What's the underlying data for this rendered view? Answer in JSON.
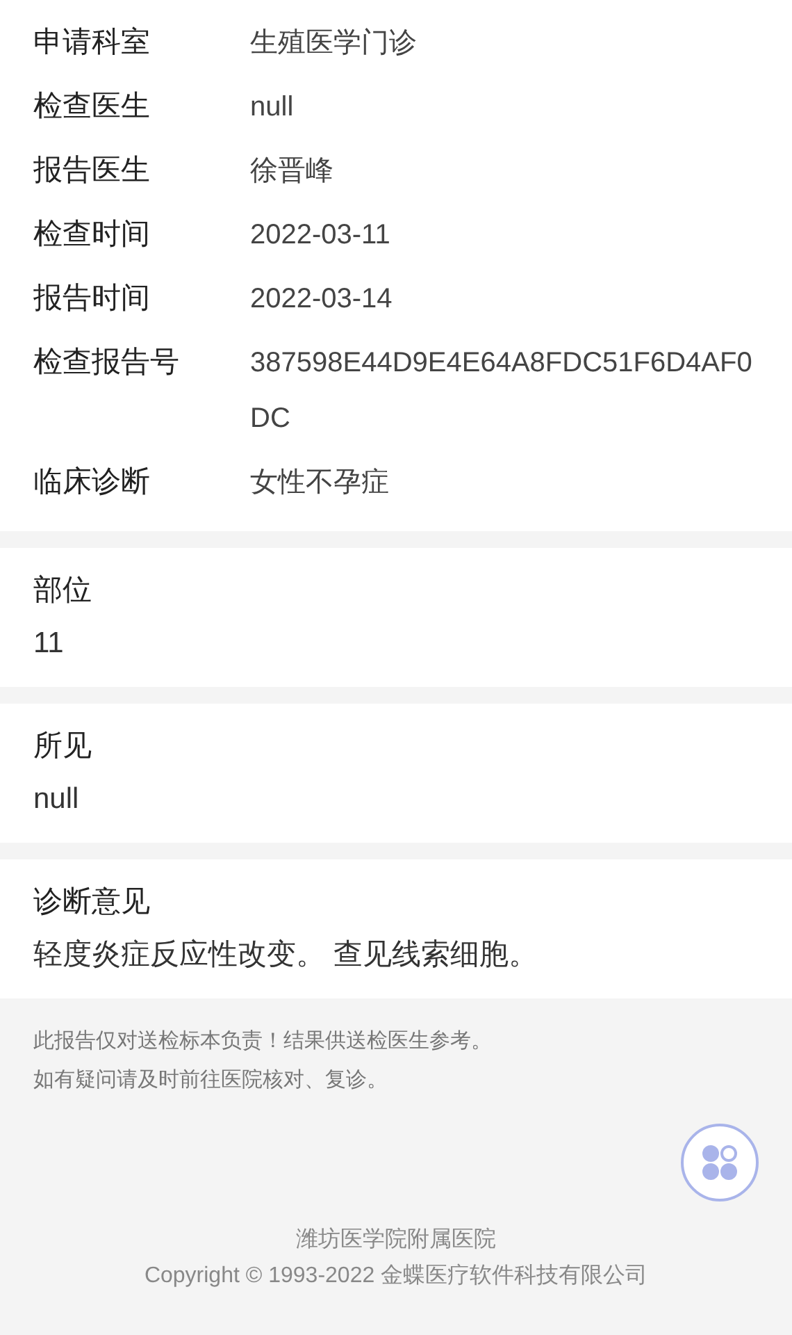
{
  "info_rows": [
    {
      "label": "申请科室",
      "value": "生殖医学门诊"
    },
    {
      "label": "检查医生",
      "value": "null"
    },
    {
      "label": "报告医生",
      "value": "徐晋峰"
    },
    {
      "label": "检查时间",
      "value": "2022-03-11"
    },
    {
      "label": "报告时间",
      "value": "2022-03-14"
    },
    {
      "label": "检查报告号",
      "value": "387598E44D9E4E64A8FDC51F6D4AF0DC"
    },
    {
      "label": "临床诊断",
      "value": "女性不孕症"
    }
  ],
  "sections": [
    {
      "title": "部位",
      "body": "11"
    },
    {
      "title": "所见",
      "body": "null"
    },
    {
      "title": "诊断意见",
      "body": "轻度炎症反应性改变。 查见线索细胞。"
    }
  ],
  "notice": [
    "此报告仅对送检标本负责！结果供送检医生参考。",
    "如有疑问请及时前往医院核对、复诊。"
  ],
  "footer": {
    "hospital": "潍坊医学院附属医院",
    "copyright": "Copyright © 1993-2022 金蝶医疗软件科技有限公司"
  }
}
